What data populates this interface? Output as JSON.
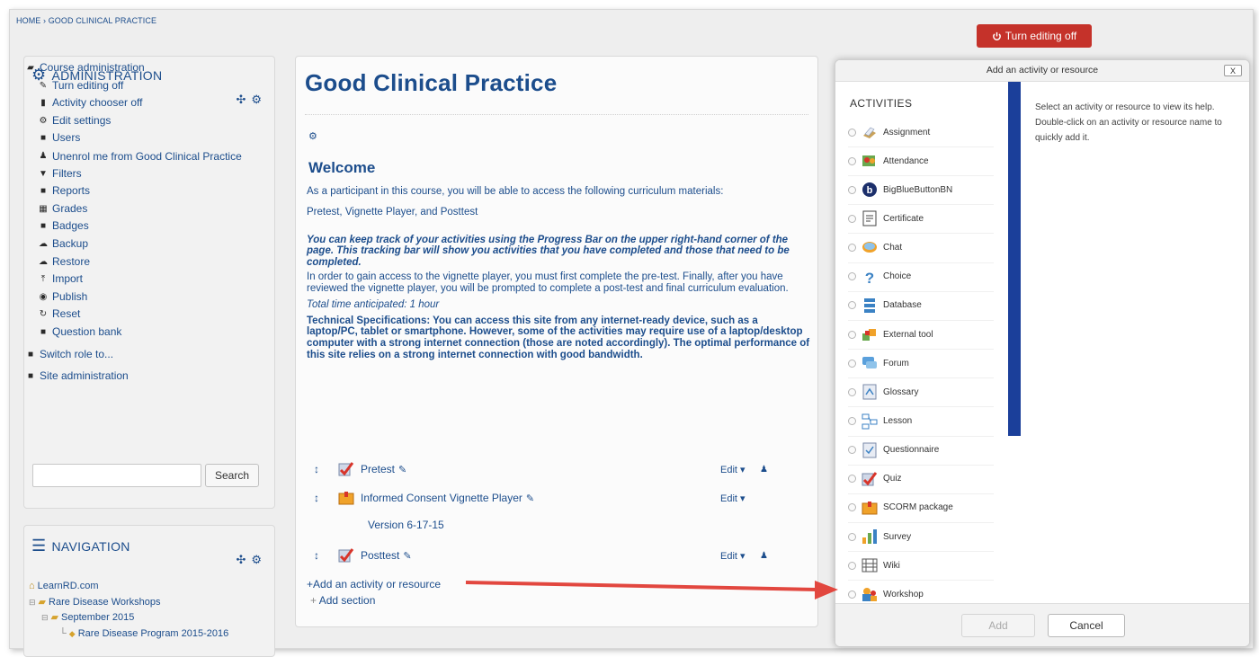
{
  "breadcrumb": "HOME › GOOD CLINICAL PRACTICE",
  "header": {
    "turn_off_label": "Turn editing off",
    "turn_off_color": "#c5322a"
  },
  "administration": {
    "title": "ADMINISTRATION",
    "course_admin": "Course administration",
    "items": [
      "Turn editing off",
      "Activity chooser off",
      "Edit settings",
      "Users",
      "Unenrol me from Good Clinical Practice",
      "Filters",
      "Reports",
      "Grades",
      "Badges",
      "Backup",
      "Restore",
      "Import",
      "Publish",
      "Reset",
      "Question bank"
    ],
    "switch_role": "Switch role to...",
    "site_admin": "Site administration",
    "search_button": "Search"
  },
  "navigation": {
    "title": "NAVIGATION",
    "tree": [
      "LearnRD.com",
      "Rare Disease Workshops",
      "September 2015",
      "Rare Disease Program 2015-2016"
    ]
  },
  "main": {
    "title": "Good Clinical Practice",
    "welcome": "Welcome",
    "p1": "As a participant in this course, you will be able to access the following curriculum materials:",
    "p2": "Pretest, Vignette Player, and Posttest",
    "p3": "You can keep track of your activities using the Progress Bar on the upper right-hand corner of the page.  This tracking bar will show you activities that you have completed and those that need to be completed.",
    "p4": "In order to gain access to the vignette player, you must first complete the pre-test. Finally, after you have reviewed  the vignette player, you will be prompted to complete a post-test and final curriculum evaluation.",
    "p5": "Total time anticipated: 1 hour",
    "p6": "Technical Specifications:  You can access this site from any internet-ready device, such as a laptop/PC, tablet or smartphone.  However, some of the activities may require use of a laptop/desktop computer with a strong internet connection (those are noted accordingly).  The optimal performance of this site relies on a strong internet connection with good bandwidth.",
    "activities": [
      {
        "name": "Pretest",
        "edit": "Edit"
      },
      {
        "name": "Informed Consent Vignette Player",
        "edit": "Edit"
      },
      {
        "name": "Posttest",
        "edit": "Edit"
      }
    ],
    "version": "Version 6-17-15",
    "add_activity": "Add an activity or resource",
    "add_section": "Add section"
  },
  "chooser": {
    "title": "Add an activity or resource",
    "close": "X",
    "section": "ACTIVITIES",
    "options": [
      "Assignment",
      "Attendance",
      "BigBlueButtonBN",
      "Certificate",
      "Chat",
      "Choice",
      "Database",
      "External tool",
      "Forum",
      "Glossary",
      "Lesson",
      "Questionnaire",
      "Quiz",
      "SCORM package",
      "Survey",
      "Wiki",
      "Workshop"
    ],
    "help": "Select an activity or resource to view its help. Double-click on an activity or resource name to quickly add it.",
    "add_button": "Add",
    "cancel_button": "Cancel",
    "accent_color": "#1b3f9a"
  }
}
